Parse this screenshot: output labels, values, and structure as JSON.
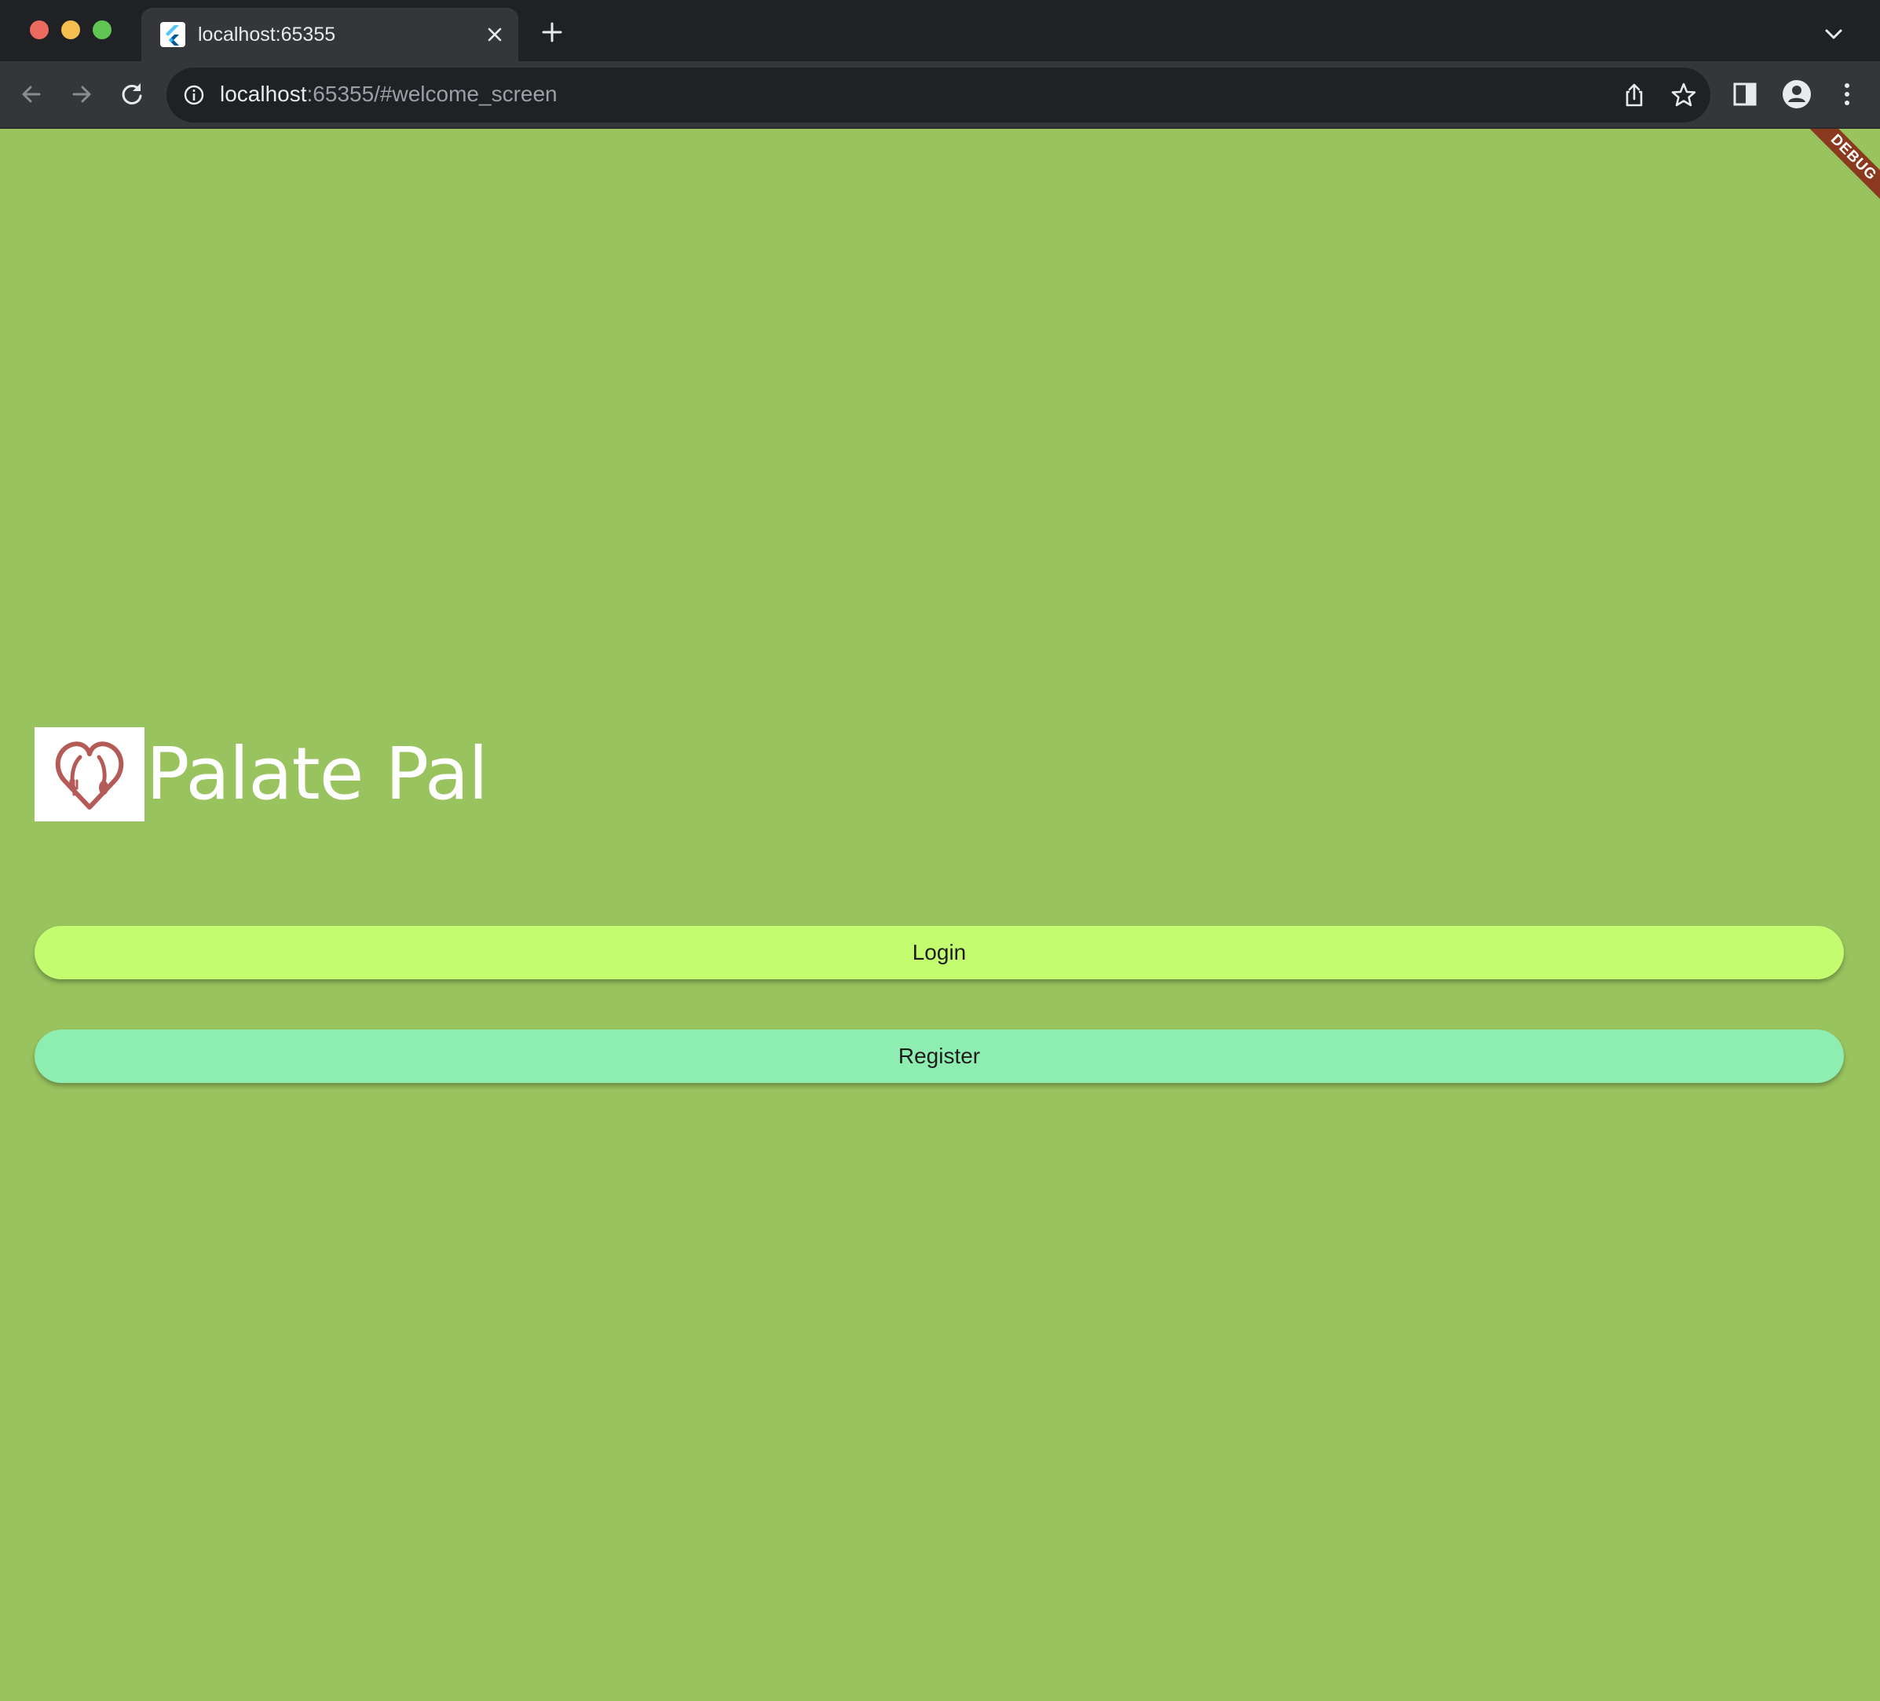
{
  "browser": {
    "tab": {
      "title": "localhost:65355"
    },
    "address": {
      "host": "localhost",
      "rest": ":65355/#welcome_screen"
    },
    "icons": {
      "back": "arrow-left-icon",
      "forward": "arrow-right-icon",
      "reload": "reload-icon",
      "info": "info-icon",
      "share": "share-icon",
      "bookmark": "star-icon",
      "side_panel": "side-panel-icon",
      "profile": "profile-icon",
      "menu": "kebab-menu-icon"
    }
  },
  "app": {
    "debug_banner": "DEBUG",
    "title": "Palate Pal",
    "logo": "heart-fork-spoon-logo",
    "buttons": {
      "login": "Login",
      "register": "Register"
    },
    "colors": {
      "background": "#99c35e",
      "login_button": "#c3fc6f",
      "register_button": "#8eedb0",
      "logo_color": "#b55b57",
      "debug_banner": "#8c3a1f"
    }
  }
}
